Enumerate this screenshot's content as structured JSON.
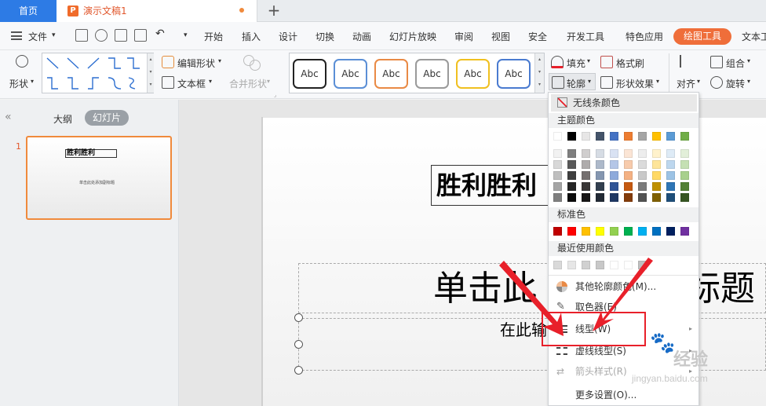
{
  "titlebar": {
    "home_tab": "首页",
    "doc_tab": "演示文稿1",
    "doc_logo": "P",
    "add_tab": "+"
  },
  "menu": {
    "file": "文件",
    "items": [
      "开始",
      "插入",
      "设计",
      "切换",
      "动画",
      "幻灯片放映",
      "审阅",
      "视图",
      "安全",
      "开发工具",
      "特色应用"
    ],
    "active": "绘图工具",
    "next": "文本工"
  },
  "ribbon": {
    "shape_label": "形状",
    "edit_shape": "编辑形状",
    "textbox": "文本框",
    "merge_shape": "合并形状",
    "style_samples": [
      "Abc",
      "Abc",
      "Abc",
      "Abc",
      "Abc",
      "Abc"
    ],
    "style_colors": [
      "#222222",
      "#5b8fd6",
      "#e98a45",
      "#9a9a9a",
      "#f0c020",
      "#4a7bd0"
    ],
    "fill": "填充",
    "outline": "轮廓",
    "format_painter": "格式刷",
    "shape_effect": "形状效果",
    "align": "对齐",
    "group": "组合",
    "rotate": "旋转"
  },
  "left_panel": {
    "outline_tab": "大纲",
    "slides_tab": "幻灯片",
    "slide_number": "1",
    "thumb_title": "胜利胜利",
    "thumb_sub": "单击此处添加副标题"
  },
  "slide": {
    "title_box": "胜利胜利",
    "title_placeholder_left": "单击此",
    "title_placeholder_right": "标题",
    "subtitle_placeholder": "在此输"
  },
  "dropdown": {
    "no_line": "无线条颜色",
    "theme_colors": "主题颜色",
    "standard_colors": "标准色",
    "recent_colors": "最近使用颜色",
    "more_colors": "其他轮廓颜色(M)...",
    "eyedropper": "取色器(E)",
    "line_type": "线型(W)",
    "dash_type": "虚线线型(S)",
    "arrow_style": "箭头样式(R)",
    "more_settings": "更多设置(O)...",
    "theme_row0": [
      "#ffffff",
      "#000000",
      "#e7e6e6",
      "#44546a",
      "#4472c4",
      "#ed7d31",
      "#a5a5a5",
      "#ffc000",
      "#5b9bd5",
      "#70ad47"
    ],
    "theme_shades": [
      [
        "#f2f2f2",
        "#7f7f7f",
        "#d0cece",
        "#d6dce4",
        "#d9e2f3",
        "#fbe5d5",
        "#ededed",
        "#fff2cc",
        "#deebf6",
        "#e2efd9"
      ],
      [
        "#d8d8d8",
        "#595959",
        "#aeabab",
        "#adb9ca",
        "#b4c6e7",
        "#f7cbac",
        "#dbdbdb",
        "#fee599",
        "#bdd7ee",
        "#c5e0b3"
      ],
      [
        "#bfbfbf",
        "#3f3f3f",
        "#757070",
        "#8496b0",
        "#8eaadb",
        "#f4b183",
        "#c9c9c9",
        "#ffd965",
        "#9cc3e5",
        "#a8d08d"
      ],
      [
        "#a5a5a5",
        "#262626",
        "#3a3838",
        "#323f4f",
        "#2f5496",
        "#c55a11",
        "#7b7b7b",
        "#bf9000",
        "#2e75b5",
        "#538135"
      ],
      [
        "#7f7f7f",
        "#0c0c0c",
        "#171616",
        "#222a35",
        "#1f3864",
        "#833c0b",
        "#525252",
        "#7f6000",
        "#1e4e79",
        "#375623"
      ]
    ],
    "standard": [
      "#c00000",
      "#ff0000",
      "#ffc000",
      "#ffff00",
      "#92d050",
      "#00b050",
      "#00b0f0",
      "#0070c0",
      "#002060",
      "#7030a0"
    ],
    "recent": [
      "#d9d9d9",
      "#e6e6e6",
      "#d0d0d0",
      "#c8c8c8",
      "#ffffff",
      "#ffffff",
      "#bfbfbf"
    ]
  },
  "accent_color": "#ef6e3a",
  "highlight_color": "#e8202a"
}
